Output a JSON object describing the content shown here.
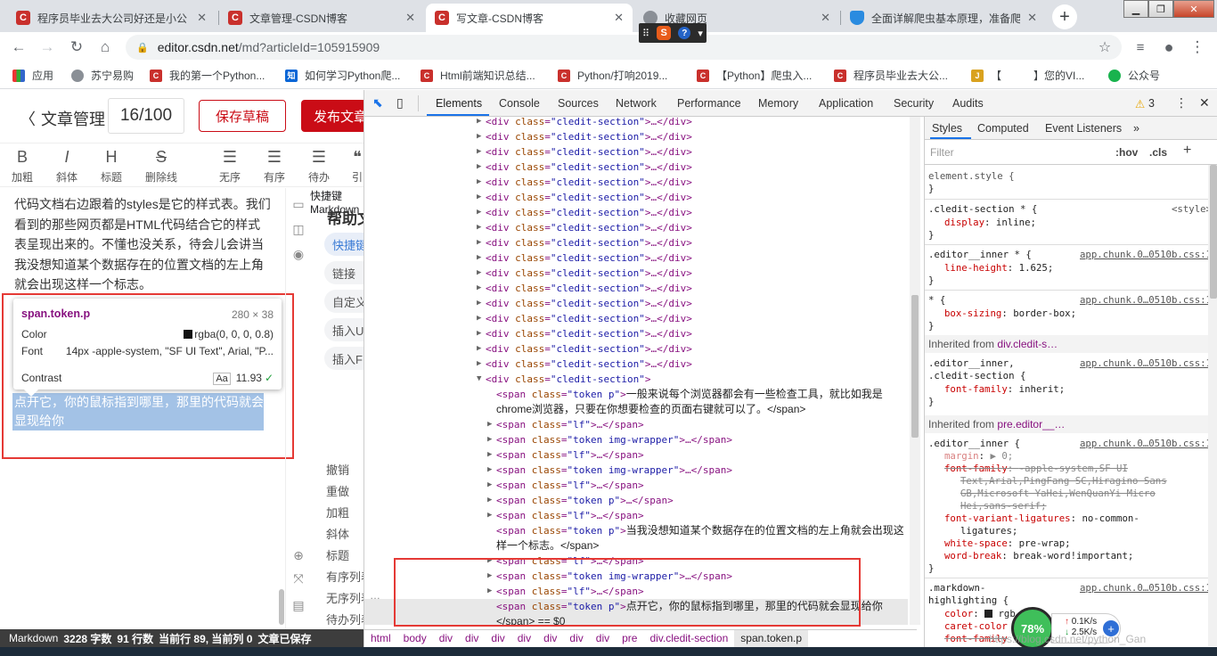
{
  "browser": {
    "tabs": [
      {
        "title": "程序员毕业去大公司好还是小公",
        "icon": "csdn-icon",
        "active": false
      },
      {
        "title": "文章管理-CSDN博客",
        "icon": "csdn-icon",
        "active": false
      },
      {
        "title": "写文章-CSDN博客",
        "icon": "csdn-icon",
        "active": true
      },
      {
        "title": "收藏网页",
        "icon": "globe-icon",
        "active": false
      },
      {
        "title": "全面详解爬虫基本原理，准备爬",
        "icon": "shield-icon",
        "active": false
      }
    ],
    "new_tab": "+",
    "url_host": "editor.csdn.net",
    "url_path": "/md?articleId=105915909",
    "bookmarks": [
      {
        "label": "应用",
        "icon": "apps-icon"
      },
      {
        "label": "苏宁易购",
        "icon": "globe-icon"
      },
      {
        "label": "我的第一个Python...",
        "icon": "csdn-icon"
      },
      {
        "label": "如何学习Python爬...",
        "icon": "zhihu-icon"
      },
      {
        "label": "Html前端知识总结...",
        "icon": "csdn-icon"
      },
      {
        "label": "Python/打响2019...",
        "icon": "csdn-icon"
      },
      {
        "label": "【Python】爬虫入...",
        "icon": "csdn-icon"
      },
      {
        "label": "程序员毕业去大公...",
        "icon": "csdn-icon"
      },
      {
        "label": "【　　　】您的VI...",
        "icon": "jd-icon"
      },
      {
        "label": "公众号",
        "icon": "wechat-icon"
      }
    ]
  },
  "editor": {
    "back_label": "文章管理",
    "title_count": "16/100",
    "save_label": "保存草稿",
    "publish_label": "发布文章",
    "tools": [
      {
        "glyph": "B",
        "label": "加粗"
      },
      {
        "glyph": "I",
        "label": "斜体"
      },
      {
        "glyph": "H",
        "label": "标题"
      },
      {
        "glyph": "S",
        "label": "删除线"
      },
      {
        "glyph": "☰",
        "label": "无序"
      },
      {
        "glyph": "☰",
        "label": "有序"
      },
      {
        "glyph": "☰",
        "label": "待办"
      },
      {
        "glyph": "❝",
        "label": "引"
      }
    ],
    "body_text": "代码文档右边跟着的styles是它的样式表。我们看到的那些网页都是HTML代码结合它的样式表呈现出来的。不懂也没关系，待会儿会讲当我没想知道某个数据存在的位置文档的左上角就会出现这样一个标志。",
    "highlight_text": "点开它，你的鼠标指到哪里，那里的代码就会显现给你",
    "tooltip": {
      "name": "span.token.p",
      "dims": "280 × 38",
      "color_label": "Color",
      "color_value": "rgba(0, 0, 0, 0.8)",
      "font_label": "Font",
      "font_value": "14px -apple-system, \"SF UI Text\", Arial, \"P...",
      "contrast_label": "Contrast",
      "contrast_value": "11.93"
    },
    "help": {
      "title": "帮助文档",
      "pills": [
        "快捷键",
        "链接",
        "自定义",
        "插入U",
        "插入F"
      ],
      "shortcuts_title": "快捷键",
      "markdown_title": "Markdown",
      "shortcuts": [
        "撤销",
        "重做",
        "加粗",
        "斜体",
        "标题",
        "有序列表",
        "无序列表",
        "待办列表"
      ]
    },
    "status": {
      "mode": "Markdown",
      "words": "3228 字数",
      "lines": "91 行数",
      "cur_line": "当前行 89, 当前列 0",
      "saved": "文章已保存"
    }
  },
  "devtools": {
    "tabs": [
      "Elements",
      "Console",
      "Sources",
      "Network",
      "Performance",
      "Memory",
      "Application",
      "Security",
      "Audits"
    ],
    "warning_count": "3",
    "dom_lines": [
      {
        "indent": 0,
        "tri": "▶",
        "kind": "div",
        "cls": "cledit-section",
        "tail": "…</div>"
      },
      {
        "indent": 0,
        "tri": "▶",
        "kind": "div",
        "cls": "cledit-section",
        "tail": "…</div>"
      },
      {
        "indent": 0,
        "tri": "▶",
        "kind": "div",
        "cls": "cledit-section",
        "tail": "…</div>"
      },
      {
        "indent": 0,
        "tri": "▶",
        "kind": "div",
        "cls": "cledit-section",
        "tail": "…</div>"
      },
      {
        "indent": 0,
        "tri": "▶",
        "kind": "div",
        "cls": "cledit-section",
        "tail": "…</div>"
      },
      {
        "indent": 0,
        "tri": "▶",
        "kind": "div",
        "cls": "cledit-section",
        "tail": "…</div>"
      },
      {
        "indent": 0,
        "tri": "▶",
        "kind": "div",
        "cls": "cledit-section",
        "tail": "…</div>"
      },
      {
        "indent": 0,
        "tri": "▶",
        "kind": "div",
        "cls": "cledit-section",
        "tail": "…</div>"
      },
      {
        "indent": 0,
        "tri": "▶",
        "kind": "div",
        "cls": "cledit-section",
        "tail": "…</div>"
      },
      {
        "indent": 0,
        "tri": "▶",
        "kind": "div",
        "cls": "cledit-section",
        "tail": "…</div>"
      },
      {
        "indent": 0,
        "tri": "▶",
        "kind": "div",
        "cls": "cledit-section",
        "tail": "…</div>"
      },
      {
        "indent": 0,
        "tri": "▶",
        "kind": "div",
        "cls": "cledit-section",
        "tail": "…</div>"
      },
      {
        "indent": 0,
        "tri": "▶",
        "kind": "div",
        "cls": "cledit-section",
        "tail": "…</div>"
      },
      {
        "indent": 0,
        "tri": "▶",
        "kind": "div",
        "cls": "cledit-section",
        "tail": "…</div>"
      },
      {
        "indent": 0,
        "tri": "▶",
        "kind": "div",
        "cls": "cledit-section",
        "tail": "…</div>"
      },
      {
        "indent": 0,
        "tri": "▶",
        "kind": "div",
        "cls": "cledit-section",
        "tail": "…</div>"
      },
      {
        "indent": 0,
        "tri": "▶",
        "kind": "div",
        "cls": "cledit-section",
        "tail": "…</div>"
      },
      {
        "indent": 0,
        "tri": "▼",
        "kind": "div",
        "cls": "cledit-section",
        "tail": ""
      },
      {
        "indent": 1,
        "tri": "",
        "kind": "span",
        "cls": "token p",
        "tail": "一般来说每个浏览器都会有一些检查工具，就比如我是"
      },
      {
        "indent": 1,
        "tri": "",
        "kind": "text",
        "cls": "",
        "tail": "chrome浏览器，只要在你想要检查的页面右键就可以了。</span>"
      },
      {
        "indent": 1,
        "tri": "▶",
        "kind": "span",
        "cls": "lf",
        "tail": "…</span>"
      },
      {
        "indent": 1,
        "tri": "▶",
        "kind": "span",
        "cls": "token img-wrapper",
        "tail": "…</span>"
      },
      {
        "indent": 1,
        "tri": "▶",
        "kind": "span",
        "cls": "lf",
        "tail": "…</span>"
      },
      {
        "indent": 1,
        "tri": "▶",
        "kind": "span",
        "cls": "token img-wrapper",
        "tail": "…</span>"
      },
      {
        "indent": 1,
        "tri": "▶",
        "kind": "span",
        "cls": "lf",
        "tail": "…</span>"
      },
      {
        "indent": 1,
        "tri": "▶",
        "kind": "span",
        "cls": "token p",
        "tail": "…</span>"
      },
      {
        "indent": 1,
        "tri": "▶",
        "kind": "span",
        "cls": "lf",
        "tail": "…</span>"
      },
      {
        "indent": 1,
        "tri": "",
        "kind": "span",
        "cls": "token p",
        "tail": "当我没想知道某个数据存在的位置文档的左上角就会出现这"
      },
      {
        "indent": 1,
        "tri": "",
        "kind": "text",
        "cls": "",
        "tail": "样一个标志。</span>"
      },
      {
        "indent": 1,
        "tri": "▶",
        "kind": "span",
        "cls": "lf",
        "tail": "…</span>"
      },
      {
        "indent": 1,
        "tri": "▶",
        "kind": "span",
        "cls": "token img-wrapper",
        "tail": "…</span>"
      },
      {
        "indent": 1,
        "tri": "▶",
        "kind": "span",
        "cls": "lf",
        "tail": "…</span>"
      },
      {
        "indent": 1,
        "tri": "",
        "kind": "span",
        "cls": "token p",
        "tail": "点开它，你的鼠标指到哪里，那里的代码就会显现给你"
      },
      {
        "indent": 1,
        "tri": "",
        "kind": "text",
        "cls": "",
        "tail": "</span> == $0"
      }
    ],
    "breadcrumbs": [
      "html",
      "body",
      "div",
      "div",
      "div",
      "div",
      "div",
      "div",
      "div",
      "pre",
      "div.cledit-section",
      "span.token.p"
    ],
    "styles": {
      "tabs": [
        "Styles",
        "Computed",
        "Event Listeners",
        "»"
      ],
      "filter_placeholder": "Filter",
      "hov": ":hov",
      "cls": ".cls",
      "rules": {
        "element_style": "element.style {",
        "r1_sel": ".cledit-section * {",
        "r1_src": "<style>",
        "r1_p": "display",
        "r1_v": "inline;",
        "r2_sel": ".editor__inner * {",
        "r2_src": "app.chunk.0…0510b.css:1",
        "r2_p": "line-height",
        "r2_v": "1.625;",
        "r3_sel": "* {",
        "r3_src": "app.chunk.0…0510b.css:1",
        "r3_p": "box-sizing",
        "r3_v": "border-box;",
        "inh1_label": "Inherited from",
        "inh1_sel": "div.cledit-s…",
        "r4_sel1": ".editor__inner,",
        "r4_sel2": ".cledit-section {",
        "r4_src": "app.chunk.0…0510b.css:1",
        "r4_p": "font-family",
        "r4_v": "inherit;",
        "inh2_label": "Inherited from",
        "inh2_sel": "pre.editor__…",
        "r5_sel": ".editor__inner {",
        "r5_src": "app.chunk.0…0510b.css:1",
        "r5_p1": "margin",
        "r5_v1": "▶ 0;",
        "r5_p2": "font-family",
        "r5_v2a": "-apple-system,SF UI",
        "r5_v2b": "Text,Arial,PingFang SC,Hiragino Sans",
        "r5_v2c": "GB,Microsoft YaHei,WenQuanYi Micro",
        "r5_v2d": "Hei,sans-serif;",
        "r5_p3": "font-variant-ligatures",
        "r5_v3a": "no-common-",
        "r5_v3b": "ligatures;",
        "r5_p4": "white-space",
        "r5_v4": "pre-wrap;",
        "r5_p5": "word-break",
        "r5_v5": "break-word!important;",
        "r6_sel1": ".markdown-",
        "r6_sel2": "highlighting {",
        "r6_src": "app.chunk.0…0510b.css:1",
        "r6_p1": "color",
        "r6_v1": "rgb",
        "r6_p2": "caret-color",
        "r6_p3": "font-family"
      }
    }
  },
  "overlay": {
    "net_percent": "78%",
    "up_rate": "0.1K/s",
    "down_rate": "2.5K/s",
    "watermark": "https://blog.csdn.net/python_Gan"
  },
  "colors": {
    "csdn_red": "#ca0c16",
    "devtools_blue": "#1a73e8",
    "annotation_red": "#e53935",
    "tag_purple": "#881280"
  }
}
